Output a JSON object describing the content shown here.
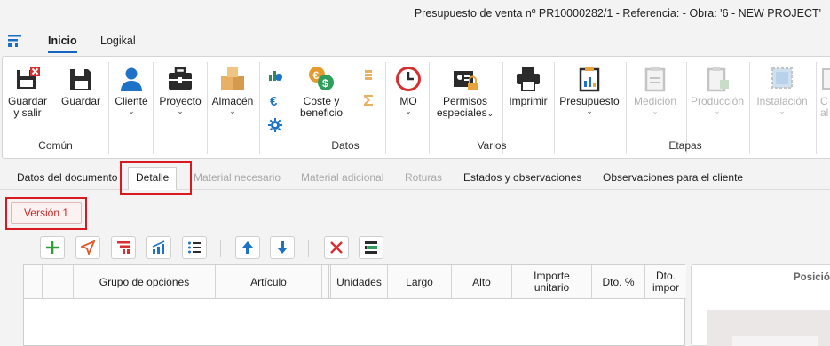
{
  "window": {
    "title": "Presupuesto de venta nº PR10000282/1 - Referencia:  - Obra: '6 - NEW PROJECT'"
  },
  "menu": {
    "tabs": [
      {
        "label": "Inicio"
      },
      {
        "label": "Logikal"
      }
    ]
  },
  "ribbon": {
    "guardar_y_salir": "Guardar\ny salir",
    "guardar": "Guardar",
    "cliente": "Cliente",
    "proyecto": "Proyecto",
    "almacen": "Almacén",
    "coste_beneficio": "Coste y\nbeneficio",
    "mo": "MO",
    "permisos": "Permisos\nespeciales",
    "imprimir": "Imprimir",
    "presupuesto": "Presupuesto",
    "medicion": "Medición",
    "produccion": "Producción",
    "instalacion": "Instalación",
    "cut_label": "C\nal",
    "groups": {
      "comun": "Común",
      "datos": "Datos",
      "varios": "Varios",
      "etapas": "Etapas"
    }
  },
  "doc_tabs": [
    {
      "label": "Datos del documento",
      "state": "normal"
    },
    {
      "label": "Detalle",
      "state": "selected"
    },
    {
      "label": "Material necesario",
      "state": "disabled"
    },
    {
      "label": "Material adicional",
      "state": "disabled"
    },
    {
      "label": "Roturas",
      "state": "disabled"
    },
    {
      "label": "Estados y observaciones",
      "state": "normal"
    },
    {
      "label": "Observaciones para el cliente",
      "state": "normal"
    }
  ],
  "version_tab": {
    "label": "Versión 1"
  },
  "grid": {
    "columns": [
      {
        "label": ""
      },
      {
        "label": ""
      },
      {
        "label": "Grupo de opciones"
      },
      {
        "label": "Artículo"
      },
      {
        "label": ""
      },
      {
        "label": "Unidades"
      },
      {
        "label": "Largo"
      },
      {
        "label": "Alto"
      },
      {
        "label": "Importe\nunitario"
      },
      {
        "label": "Dto. %"
      },
      {
        "label": "Dto.\nimpor"
      }
    ]
  },
  "right_panel": {
    "title": "Posició"
  },
  "colors": {
    "accent": "#1565c0",
    "highlight": "#d9191f",
    "disabled": "#b3b3b3"
  }
}
